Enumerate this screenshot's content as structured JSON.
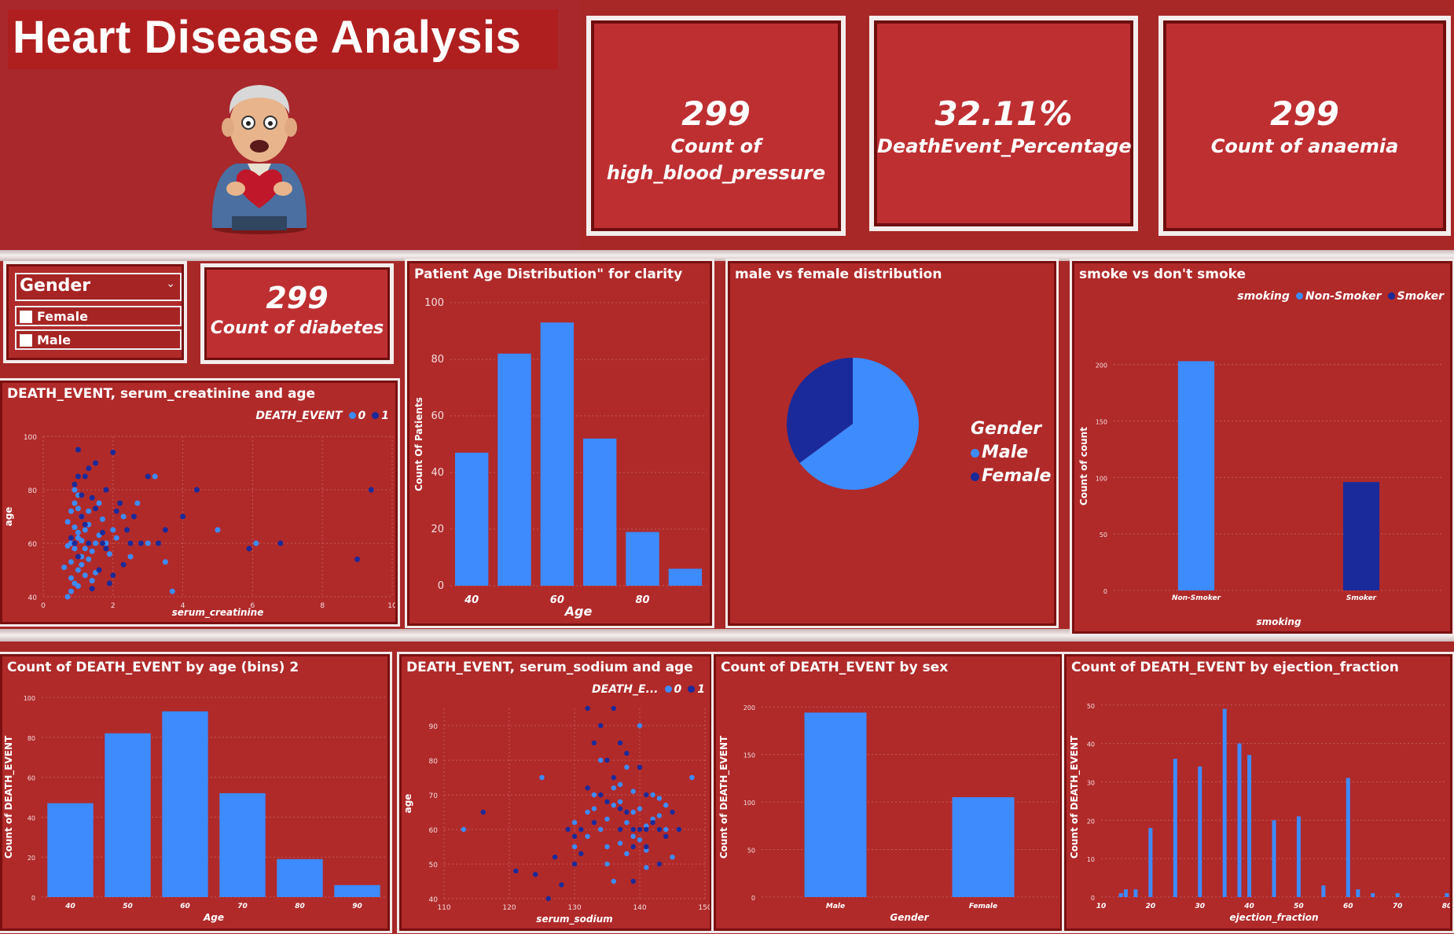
{
  "header": {
    "title": "Heart Disease Analysis",
    "illustration_icon": "elderly-man-holding-heart-icon"
  },
  "colors": {
    "background": "#a82828",
    "panel": "#b02a2a",
    "series_light": "#3d8bfd",
    "series_dark": "#1a2a9a"
  },
  "kpis": [
    {
      "value": "299",
      "label_line1": "Count of",
      "label_line2": "high_blood_pressure"
    },
    {
      "value": "32.11%",
      "label_line1": "DeathEvent_Percentage",
      "label_line2": ""
    },
    {
      "value": "299",
      "label_line1": "Count of anaemia",
      "label_line2": ""
    },
    {
      "value": "299",
      "label_line1": "Count of diabetes",
      "label_line2": ""
    }
  ],
  "slicer": {
    "title": "Gender",
    "options": [
      "Female",
      "Male"
    ]
  },
  "chart_data": [
    {
      "id": "age_dist",
      "type": "bar",
      "title": "Patient Age Distribution\" for clarity",
      "xlabel": "Age",
      "ylabel": "Count Of Patients",
      "categories": [
        40,
        50,
        60,
        70,
        80,
        90
      ],
      "values": [
        47,
        82,
        93,
        52,
        19,
        6
      ],
      "ylim": [
        0,
        100
      ],
      "yticks": [
        0,
        20,
        40,
        60,
        80,
        100
      ],
      "xtick_labels": [
        "40",
        "",
        "60",
        "",
        "80",
        ""
      ]
    },
    {
      "id": "gender_pie",
      "type": "pie",
      "title": "male vs female distribution",
      "legend_title": "Gender",
      "slices": [
        {
          "name": "Male",
          "value": 194,
          "color": "#3d8bfd"
        },
        {
          "name": "Female",
          "value": 105,
          "color": "#1a2a9a"
        }
      ]
    },
    {
      "id": "smoke",
      "type": "bar",
      "title": "smoke vs don't smoke",
      "legend_title": "smoking",
      "xlabel": "smoking",
      "ylabel": "Count of count",
      "categories": [
        "Non-Smoker",
        "Smoker"
      ],
      "values": [
        203,
        96
      ],
      "ylim": [
        0,
        220
      ],
      "yticks": [
        0,
        50,
        100,
        150,
        200
      ],
      "series_names": [
        "Non-Smoker",
        "Smoker"
      ]
    },
    {
      "id": "creat_scatter",
      "type": "scatter",
      "title": "DEATH_EVENT, serum_creatinine and age",
      "legend_title": "DEATH_EVENT",
      "series_names": [
        "0",
        "1"
      ],
      "xlabel": "serum_creatinine",
      "ylabel": "age",
      "xlim": [
        0,
        10
      ],
      "ylim": [
        40,
        100
      ],
      "xticks": [
        0,
        2,
        4,
        6,
        8,
        10
      ],
      "yticks": [
        40,
        60,
        80,
        100
      ],
      "series": [
        {
          "name": "0",
          "points": [
            [
              0.7,
              40
            ],
            [
              0.8,
              42
            ],
            [
              0.9,
              45
            ],
            [
              1.0,
              50
            ],
            [
              1.1,
              55
            ],
            [
              0.9,
              58
            ],
            [
              0.8,
              60
            ],
            [
              1.0,
              62
            ],
            [
              1.2,
              65
            ],
            [
              0.7,
              68
            ],
            [
              1.1,
              70
            ],
            [
              1.3,
              72
            ],
            [
              0.9,
              75
            ],
            [
              1.0,
              78
            ],
            [
              0.8,
              53
            ],
            [
              1.2,
              48
            ],
            [
              1.4,
              57
            ],
            [
              1.5,
              60
            ],
            [
              1.6,
              63
            ],
            [
              1.0,
              44
            ],
            [
              0.6,
              51
            ],
            [
              0.9,
              66
            ],
            [
              1.1,
              61
            ],
            [
              1.3,
              54
            ],
            [
              1.2,
              58
            ],
            [
              1.8,
              60
            ],
            [
              2.1,
              62
            ],
            [
              2.5,
              55
            ],
            [
              3.0,
              60
            ],
            [
              3.5,
              53
            ],
            [
              3.7,
              42
            ],
            [
              5.0,
              65
            ],
            [
              6.1,
              60
            ],
            [
              1.0,
              73
            ],
            [
              0.9,
              80
            ],
            [
              1.7,
              69
            ],
            [
              2.3,
              70
            ],
            [
              1.4,
              46
            ],
            [
              0.8,
              47
            ],
            [
              1.1,
              52
            ],
            [
              1.9,
              56
            ],
            [
              1.0,
              64
            ],
            [
              0.7,
              59
            ],
            [
              1.3,
              67
            ],
            [
              1.5,
              49
            ],
            [
              2.0,
              65
            ],
            [
              2.7,
              75
            ],
            [
              3.2,
              85
            ],
            [
              1.6,
              75
            ],
            [
              0.8,
              72
            ]
          ]
        },
        {
          "name": "1",
          "points": [
            [
              1.0,
              95
            ],
            [
              1.5,
              90
            ],
            [
              2.0,
              94
            ],
            [
              1.2,
              85
            ],
            [
              0.9,
              82
            ],
            [
              1.8,
              80
            ],
            [
              2.2,
              75
            ],
            [
              2.6,
              70
            ],
            [
              3.0,
              85
            ],
            [
              4.4,
              80
            ],
            [
              9.4,
              80
            ],
            [
              3.5,
              65
            ],
            [
              4.0,
              70
            ],
            [
              6.8,
              60
            ],
            [
              5.9,
              58
            ],
            [
              9.0,
              54
            ],
            [
              1.3,
              60
            ],
            [
              1.7,
              64
            ],
            [
              2.5,
              60
            ],
            [
              3.3,
              60
            ],
            [
              1.1,
              70
            ],
            [
              1.4,
              77
            ],
            [
              2.1,
              72
            ],
            [
              0.9,
              60
            ],
            [
              1.6,
              50
            ],
            [
              1.9,
              45
            ],
            [
              2.3,
              52
            ],
            [
              1.0,
              55
            ],
            [
              1.2,
              67
            ],
            [
              1.8,
              58
            ],
            [
              0.8,
              62
            ],
            [
              1.5,
              73
            ],
            [
              2.8,
              60
            ],
            [
              1.4,
              43
            ],
            [
              2.0,
              48
            ],
            [
              1.0,
              85
            ],
            [
              1.3,
              88
            ],
            [
              1.7,
              60
            ],
            [
              2.4,
              65
            ],
            [
              1.1,
              78
            ]
          ]
        }
      ]
    },
    {
      "id": "age_bins",
      "type": "bar",
      "title": "Count of DEATH_EVENT by age (bins) 2",
      "xlabel": "Age",
      "ylabel": "Count of DEATH_EVENT",
      "categories": [
        "40",
        "50",
        "60",
        "70",
        "80",
        "90"
      ],
      "values": [
        47,
        82,
        93,
        52,
        19,
        6
      ],
      "ylim": [
        0,
        100
      ],
      "yticks": [
        0,
        20,
        40,
        60,
        80,
        100
      ]
    },
    {
      "id": "sodium_scatter",
      "type": "scatter",
      "title": "DEATH_EVENT, serum_sodium and age",
      "legend_title": "DEATH_E...",
      "series_names": [
        "0",
        "1"
      ],
      "xlabel": "serum_sodium",
      "ylabel": "age",
      "xlim": [
        110,
        150
      ],
      "ylim": [
        40,
        95
      ],
      "xticks": [
        110,
        120,
        130,
        140,
        150
      ],
      "yticks": [
        40,
        50,
        60,
        70,
        80,
        90
      ],
      "series": [
        {
          "name": "0",
          "points": [
            [
              113,
              60
            ],
            [
              125,
              75
            ],
            [
              130,
              55
            ],
            [
              132,
              65
            ],
            [
              133,
              70
            ],
            [
              134,
              60
            ],
            [
              135,
              50
            ],
            [
              136,
              72
            ],
            [
              137,
              68
            ],
            [
              138,
              62
            ],
            [
              139,
              58
            ],
            [
              140,
              66
            ],
            [
              141,
              54
            ],
            [
              142,
              70
            ],
            [
              143,
              64
            ],
            [
              144,
              60
            ],
            [
              145,
              52
            ],
            [
              136,
              45
            ],
            [
              138,
              78
            ],
            [
              140,
              90
            ],
            [
              146,
              60
            ],
            [
              148,
              75
            ],
            [
              134,
              80
            ],
            [
              137,
              56
            ],
            [
              139,
              65
            ],
            [
              141,
              61
            ],
            [
              143,
              69
            ],
            [
              135,
              63
            ],
            [
              132,
              58
            ],
            [
              130,
              62
            ],
            [
              136,
              67
            ],
            [
              138,
              53
            ],
            [
              140,
              57
            ],
            [
              142,
              63
            ],
            [
              144,
              67
            ],
            [
              137,
              73
            ],
            [
              139,
              71
            ],
            [
              141,
              49
            ],
            [
              135,
              55
            ],
            [
              133,
              66
            ]
          ]
        },
        {
          "name": "1",
          "points": [
            [
              116,
              65
            ],
            [
              121,
              48
            ],
            [
              124,
              47
            ],
            [
              127,
              52
            ],
            [
              130,
              50
            ],
            [
              131,
              60
            ],
            [
              132,
              95
            ],
            [
              133,
              85
            ],
            [
              134,
              90
            ],
            [
              135,
              80
            ],
            [
              136,
              75
            ],
            [
              137,
              85
            ],
            [
              138,
              65
            ],
            [
              139,
              55
            ],
            [
              140,
              60
            ],
            [
              141,
              70
            ],
            [
              142,
              62
            ],
            [
              143,
              60
            ],
            [
              144,
              58
            ],
            [
              145,
              65
            ],
            [
              146,
              60
            ],
            [
              136,
              95
            ],
            [
              134,
              70
            ],
            [
              132,
              72
            ],
            [
              138,
              82
            ],
            [
              140,
              78
            ],
            [
              130,
              58
            ],
            [
              133,
              62
            ],
            [
              137,
              66
            ],
            [
              139,
              45
            ],
            [
              141,
              55
            ],
            [
              143,
              50
            ],
            [
              135,
              68
            ],
            [
              131,
              53
            ],
            [
              137,
              60
            ],
            [
              139,
              60
            ],
            [
              141,
              60
            ],
            [
              129,
              60
            ],
            [
              128,
              44
            ],
            [
              126,
              40
            ]
          ]
        }
      ]
    },
    {
      "id": "death_sex",
      "type": "bar",
      "title": "Count of DEATH_EVENT by sex",
      "xlabel": "Gender",
      "ylabel": "Count of DEATH_EVENT",
      "categories": [
        "Male",
        "Female"
      ],
      "values": [
        194,
        105
      ],
      "ylim": [
        0,
        210
      ],
      "yticks": [
        0,
        50,
        100,
        150,
        200
      ]
    },
    {
      "id": "ejection",
      "type": "bar",
      "title": "Count of DEATH_EVENT by ejection_fraction",
      "xlabel": "ejection_fraction",
      "ylabel": "Count of DEATH_EVENT",
      "x": [
        14,
        15,
        17,
        20,
        25,
        30,
        35,
        38,
        40,
        45,
        50,
        55,
        60,
        62,
        65,
        70,
        80
      ],
      "values": [
        1,
        2,
        2,
        18,
        36,
        34,
        49,
        40,
        37,
        20,
        21,
        3,
        31,
        2,
        1,
        1,
        1
      ],
      "xlim": [
        10,
        80
      ],
      "ylim": [
        0,
        52
      ],
      "xticks": [
        10,
        20,
        30,
        40,
        50,
        60,
        70,
        80
      ],
      "yticks": [
        0,
        10,
        20,
        30,
        40,
        50
      ]
    }
  ]
}
